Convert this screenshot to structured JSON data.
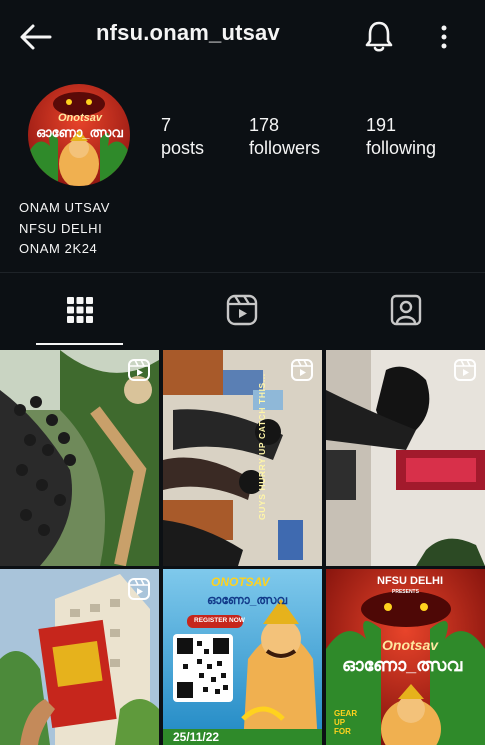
{
  "header": {
    "username": "nfsu.onam_utsav"
  },
  "profile": {
    "avatar": {
      "title": "Onotsav",
      "subtitle": "ഓണോ_ത്സവ"
    },
    "stats": [
      {
        "value": "7",
        "label": "posts"
      },
      {
        "value": "178",
        "label": "followers"
      },
      {
        "value": "191",
        "label": "following"
      }
    ],
    "bio": [
      "ONAM UTSAV",
      "NFSU DELHI",
      "ONAM 2K24"
    ]
  },
  "tabs": [
    {
      "icon": "grid-icon",
      "active": true
    },
    {
      "icon": "reels-icon",
      "active": false
    },
    {
      "icon": "tagged-icon",
      "active": false
    }
  ],
  "posts": [
    {
      "type": "reel",
      "scene": "crowd photo"
    },
    {
      "type": "reel",
      "scene": "group photo",
      "overlay": "GUYS HURRY UP CATCH THIS..."
    },
    {
      "type": "reel",
      "scene": "hallway photo"
    },
    {
      "type": "reel",
      "scene": "building with poster"
    },
    {
      "type": "image",
      "title": "ONOTSAV",
      "subtitle": "ഓണോ_ത്സവ",
      "cta": "REGISTER NOW",
      "footer": "25/11/22"
    },
    {
      "type": "image",
      "title": "NFSU DELHI",
      "presents": "PRESENTS",
      "name": "Onotsav",
      "subtitle": "ഓണോ_ത്സവ",
      "tag": "GEAR UP FOR"
    }
  ],
  "colors": {
    "background": "#0c1014",
    "text": "#f5f5f5",
    "poster_red": "#c6261c",
    "poster_yellow": "#ffd21e",
    "poster_blue": "#1f88c4"
  }
}
